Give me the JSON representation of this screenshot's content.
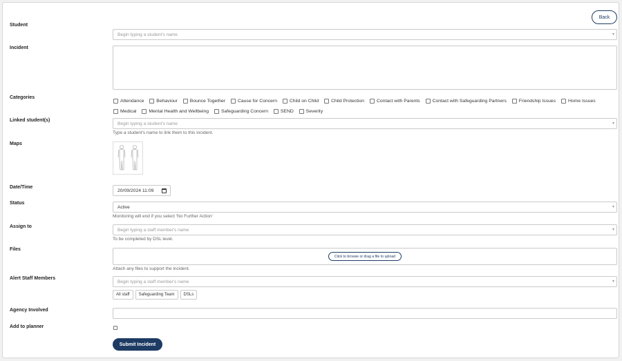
{
  "header": {
    "back_label": "Back"
  },
  "form": {
    "student": {
      "label": "Student",
      "placeholder": "Begin typing a student's name"
    },
    "incident": {
      "label": "Incident"
    },
    "categories": {
      "label": "Categories",
      "items": [
        "Attendance",
        "Behaviour",
        "Bounce Together",
        "Cause for Concern",
        "Child on Child",
        "Child Protection",
        "Contact with Parents",
        "Contact with Safeguarding Partners",
        "Friendship Issues",
        "Home Issues",
        "Medical",
        "Mental Health and Wellbeing",
        "Safeguarding Concern",
        "SEND",
        "Severity"
      ]
    },
    "linked": {
      "label": "Linked student(s)",
      "placeholder": "Begin typing a student's name",
      "help": "Type a student's name to link them to this incident."
    },
    "maps": {
      "label": "Maps"
    },
    "datetime": {
      "label": "Date/Time",
      "value": "20/09/2024 11:09"
    },
    "status": {
      "label": "Status",
      "value": "Active",
      "help": "Monitoring will end if you select 'No Further Action'"
    },
    "assign": {
      "label": "Assign to",
      "placeholder": "Begin typing a staff member's name",
      "help": "To be completed by DSL level."
    },
    "files": {
      "label": "Files",
      "upload_label": "Click to browse or drag a file to upload",
      "help": "Attach any files to support the incident."
    },
    "alert": {
      "label": "Alert Staff Members",
      "placeholder": "Begin typing a staff member's name",
      "chips": [
        "All staff",
        "Safeguarding Team",
        "DSLs"
      ]
    },
    "agency": {
      "label": "Agency Involved"
    },
    "planner": {
      "label": "Add to planner"
    },
    "submit_label": "Submit Incident"
  },
  "icons": {
    "caret": "caret-down-icon",
    "calendar": "calendar-icon",
    "body-map": "body-map-icon"
  },
  "colors": {
    "primary": "#1d3b63",
    "border": "#c9c9c9",
    "background": "#f1f1f1"
  }
}
